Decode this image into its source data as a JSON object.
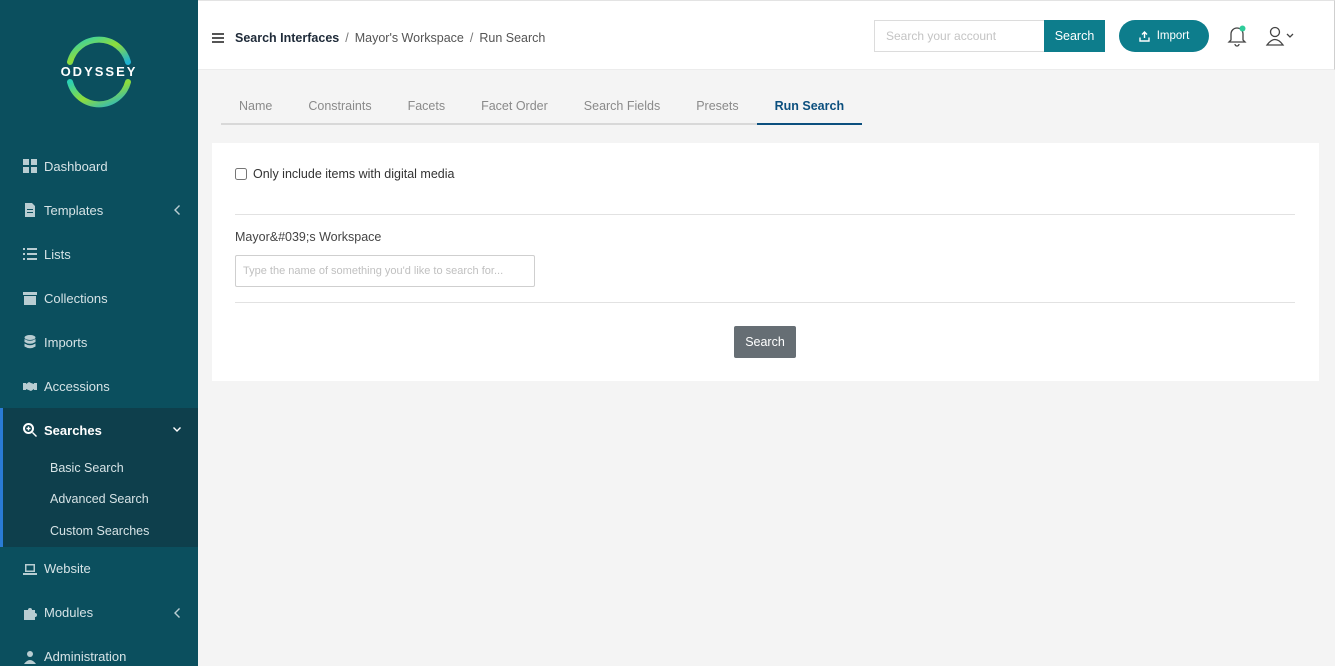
{
  "brand": {
    "name": "ODYSSEY"
  },
  "sidebar": {
    "items": [
      {
        "label": "Dashboard",
        "icon": "dashboard-icon"
      },
      {
        "label": "Templates",
        "icon": "document-icon",
        "has_submenu": true
      },
      {
        "label": "Lists",
        "icon": "list-icon"
      },
      {
        "label": "Collections",
        "icon": "archive-icon"
      },
      {
        "label": "Imports",
        "icon": "database-icon"
      },
      {
        "label": "Accessions",
        "icon": "handshake-icon"
      },
      {
        "label": "Searches",
        "icon": "search-plus-icon",
        "expanded": true
      },
      {
        "label": "Website",
        "icon": "laptop-icon"
      },
      {
        "label": "Modules",
        "icon": "puzzle-icon",
        "has_submenu": true
      },
      {
        "label": "Administration",
        "icon": "user-icon"
      }
    ],
    "searches_sub": [
      "Basic Search",
      "Advanced Search",
      "Custom Searches"
    ]
  },
  "header": {
    "breadcrumb": [
      "Search Interfaces",
      "Mayor's Workspace",
      "Run Search"
    ],
    "search_placeholder": "Search your account",
    "search_label": "Search",
    "import_label": "Import"
  },
  "tabs": [
    "Name",
    "Constraints",
    "Facets",
    "Facet Order",
    "Search Fields",
    "Presets",
    "Run Search"
  ],
  "active_tab": "Run Search",
  "panel": {
    "checkbox_label": "Only include items with digital media",
    "field_label": "Mayor&#039;s Workspace",
    "field_placeholder": "Type the name of something you'd like to search for...",
    "submit_label": "Search"
  },
  "colors": {
    "sidebar_bg": "#0b4f5e",
    "accent": "#0d7d8c",
    "active_tab": "#0b4f7e",
    "notification_dot": "#2ecc9a"
  }
}
